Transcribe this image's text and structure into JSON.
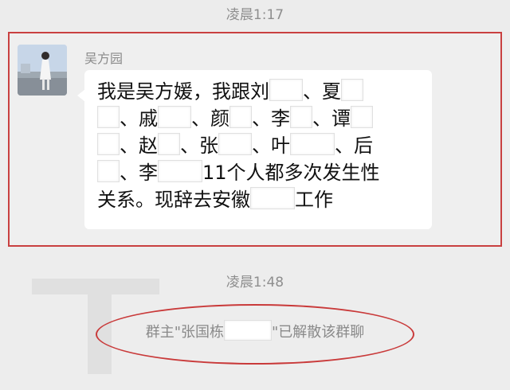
{
  "chat": {
    "time_top": "凌晨1:17",
    "sender": "吴方园",
    "message_line_1": "我是吴方媛，我跟刘",
    "message_line_1b": "、夏",
    "message_line_2a": "、戚",
    "message_line_2b": "、颜",
    "message_line_2c": "、李",
    "message_line_2d": "、谭",
    "message_line_3a": "、赵",
    "message_line_3b": "、张",
    "message_line_3c": "、叶",
    "message_line_3d": "、后",
    "message_line_4a": "、李",
    "message_line_4b": "11个人都多次发生性",
    "message_line_5": "关系。现辞去安徽",
    "message_line_5b": "工作",
    "time_mid": "凌晨1:48",
    "system_prefix": "群主\"张国栋",
    "system_suffix": "\"已解散该群聊"
  },
  "icons": {
    "avatar": "user-photo-avatar"
  }
}
